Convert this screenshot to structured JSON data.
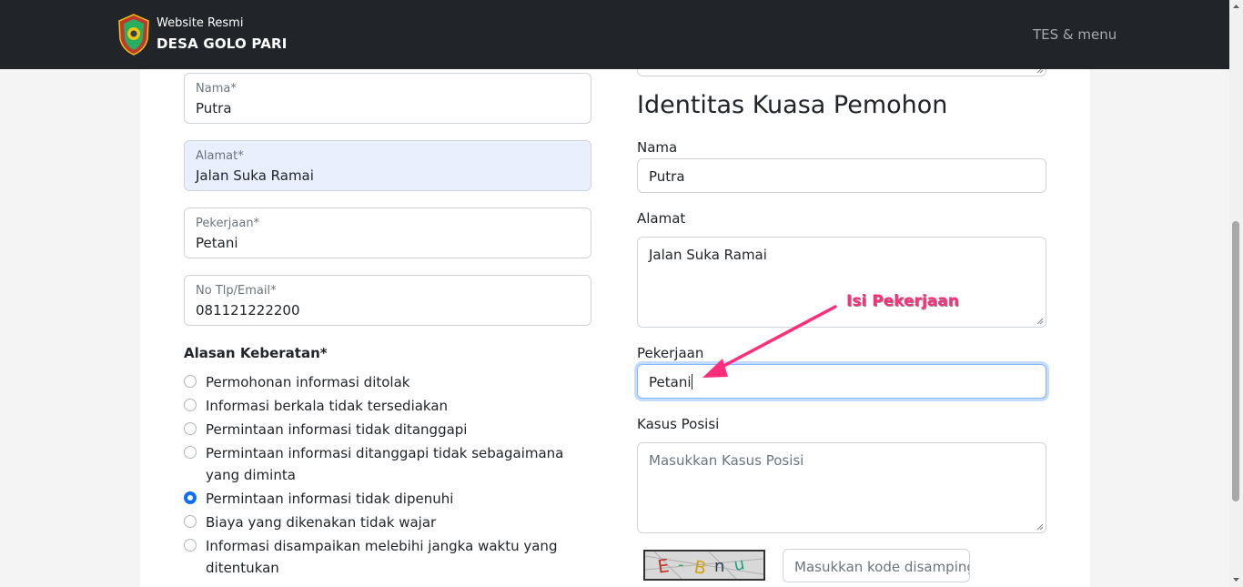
{
  "header": {
    "brand_subtitle": "Website Resmi",
    "brand_name": "DESA GOLO PARI",
    "menu_label": "TES & menu"
  },
  "left_form": {
    "fields": [
      {
        "label": "Nama*",
        "value": "Putra"
      },
      {
        "label": "Alamat*",
        "value": "Jalan Suka Ramai"
      },
      {
        "label": "Pekerjaan*",
        "value": "Petani"
      },
      {
        "label": "No Tlp/Email*",
        "value": "081121222200"
      }
    ],
    "reasons_title": "Alasan Keberatan*",
    "reasons": [
      {
        "text": "Permohonan informasi ditolak",
        "checked": false
      },
      {
        "text": "Informasi berkala tidak tersediakan",
        "checked": false
      },
      {
        "text": "Permintaan informasi tidak ditanggapi",
        "checked": false
      },
      {
        "text": "Permintaan informasi ditanggapi tidak sebagaimana yang diminta",
        "checked": false
      },
      {
        "text": "Permintaan informasi tidak dipenuhi",
        "checked": true
      },
      {
        "text": "Biaya yang dikenakan tidak wajar",
        "checked": false
      },
      {
        "text": "Informasi disampaikan melebihi jangka waktu yang ditentukan",
        "checked": false
      }
    ]
  },
  "right_form": {
    "title": "Identitas Kuasa Pemohon",
    "nama_label": "Nama",
    "nama_value": "Putra",
    "alamat_label": "Alamat",
    "alamat_value": "Jalan Suka Ramai",
    "pekerjaan_label": "Pekerjaan",
    "pekerjaan_value": "Petani",
    "kasus_label": "Kasus Posisi",
    "kasus_placeholder": "Masukkan Kasus Posisi",
    "captcha_placeholder": "Masukkan kode disamping"
  },
  "annotation": {
    "text": "Isi Pekerjaan",
    "color": "#ff2d7a"
  },
  "colors": {
    "navbar": "#212529",
    "primary": "#0d6efd",
    "autofill": "#e8f0fe"
  }
}
